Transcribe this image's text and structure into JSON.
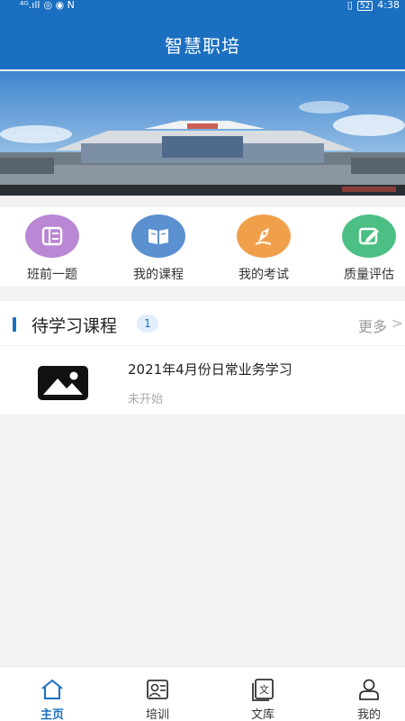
{
  "status_bar": {
    "signal": "⁴ᴳ.ıll",
    "indicators": "◎ ◉ N",
    "right_icons": "▯ ",
    "battery": "52",
    "time": "4:38"
  },
  "header": {
    "title": "智慧职培"
  },
  "banner": {
    "icon": "train-station-photo"
  },
  "quick_menu": {
    "items": [
      {
        "label": "班前一题",
        "icon": "daily-question-icon",
        "color": "#b987d4"
      },
      {
        "label": "我的课程",
        "icon": "book-icon",
        "color": "#5a8fd0"
      },
      {
        "label": "我的考试",
        "icon": "exam-pen-icon",
        "color": "#f0a04b"
      },
      {
        "label": "质量评估",
        "icon": "edit-note-icon",
        "color": "#4bbf84"
      }
    ]
  },
  "pending_courses": {
    "title": "待学习课程",
    "count": "1",
    "more": "更多",
    "items": [
      {
        "name": "2021年4月份日常业务学习",
        "status": "未开始",
        "thumb_icon": "image-placeholder-icon"
      }
    ]
  },
  "bottom_nav": {
    "items": [
      {
        "label": "主页",
        "icon": "home-icon",
        "active": true
      },
      {
        "label": "培训",
        "icon": "training-icon",
        "active": false
      },
      {
        "label": "文库",
        "icon": "library-icon",
        "active": false
      },
      {
        "label": "我的",
        "icon": "profile-icon",
        "active": false
      }
    ]
  },
  "colors": {
    "primary": "#1b6fc0",
    "background": "#f3f1f2"
  }
}
